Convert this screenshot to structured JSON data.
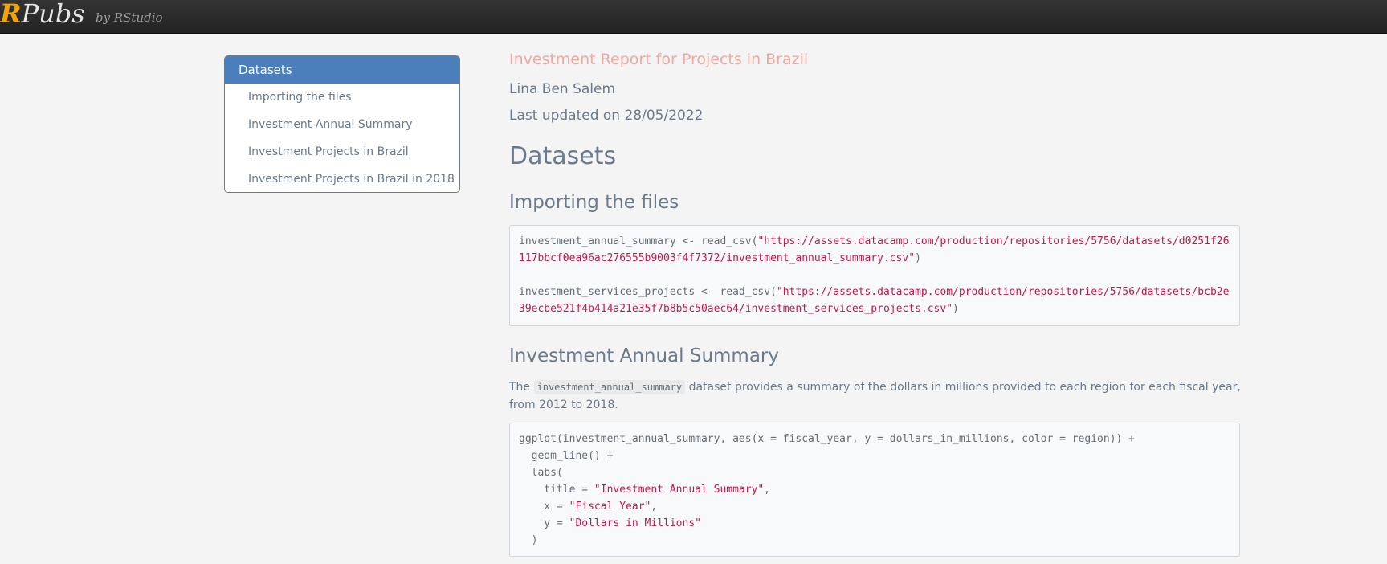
{
  "header": {
    "brand_r": "R",
    "brand_pubs": "Pubs",
    "byline": "by RStudio"
  },
  "toc": {
    "heading": "Datasets",
    "items": [
      {
        "label": "Importing the files"
      },
      {
        "label": "Investment Annual Summary"
      },
      {
        "label": "Investment Projects in Brazil"
      },
      {
        "label": "Investment Projects in Brazil in 2018"
      }
    ]
  },
  "report": {
    "title": "Investment Report for Projects in Brazil",
    "author": "Lina Ben Salem",
    "updated": "Last updated on 28/05/2022",
    "section_title": "Datasets",
    "importing": {
      "heading": "Importing the files",
      "code": {
        "l1_a": "investment_annual_summary <- read_csv(",
        "l1_s": "\"https://assets.datacamp.com/production/repositories/5756/datasets/d0251f26",
        "l2_s": "117bbcf0ea96ac276555b9003f4f7372/investment_annual_summary.csv\"",
        "l2_b": ")",
        "l4_a": "investment_services_projects <- read_csv(",
        "l4_s": "\"https://assets.datacamp.com/production/repositories/5756/datasets/bcb2e",
        "l5_s": "39ecbe521f4b414a21e35f7b8b5c50aec64/investment_services_projects.csv\"",
        "l5_b": ")"
      }
    },
    "annual": {
      "heading": "Investment Annual Summary",
      "para_pre": "The ",
      "para_code": "investment_annual_summary",
      "para_post": " dataset provides a summary of the dollars in millions provided to each region for each fiscal year, from 2012 to 2018.",
      "code": {
        "l1": "ggplot(investment_annual_summary, aes(x = fiscal_year, y = dollars_in_millions, color = region)) +",
        "l2": "  geom_line() +",
        "l3": "  labs(",
        "l4_a": "    title = ",
        "l4_s": "\"Investment Annual Summary\"",
        "l4_b": ",",
        "l5_a": "    x = ",
        "l5_s": "\"Fiscal Year\"",
        "l5_b": ",",
        "l6_a": "    y = ",
        "l6_s": "\"Dollars in Millions\"",
        "l7": "  )"
      }
    }
  }
}
